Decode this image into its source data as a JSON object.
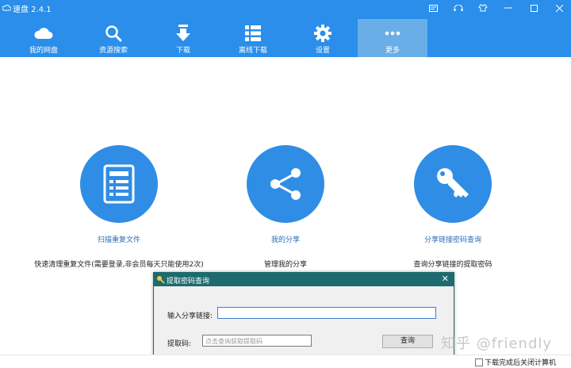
{
  "app": {
    "title": "速盘 2.4.1"
  },
  "nav": [
    {
      "label": "我的网盘",
      "icon": "cloud-icon"
    },
    {
      "label": "资源搜索",
      "icon": "search-icon"
    },
    {
      "label": "下载",
      "icon": "download-icon"
    },
    {
      "label": "离线下载",
      "icon": "list-icon"
    },
    {
      "label": "设置",
      "icon": "gear-icon"
    },
    {
      "label": "更多",
      "icon": "more-icon"
    }
  ],
  "features": [
    {
      "title": "扫描重复文件",
      "desc": "快速清理重复文件(需要登录,非会员每天只能使用2次)",
      "icon": "document-icon"
    },
    {
      "title": "我的分享",
      "desc": "管理我的分享",
      "icon": "share-icon"
    },
    {
      "title": "分享链接密码查询",
      "desc": "查询分享链接的提取密码",
      "icon": "key-icon"
    }
  ],
  "dialog": {
    "title": "提取密码查询",
    "link_label": "输入分享链接:",
    "link_value": "",
    "code_label": "提取码:",
    "code_placeholder": "点击查询获取提取码",
    "query_button": "查询"
  },
  "status": {
    "shutdown_label": "下载完成后关闭计算机"
  },
  "watermark": "知乎 @friendly",
  "colors": {
    "accent": "#2a8eea",
    "dialog_title": "#1d6b6e"
  }
}
